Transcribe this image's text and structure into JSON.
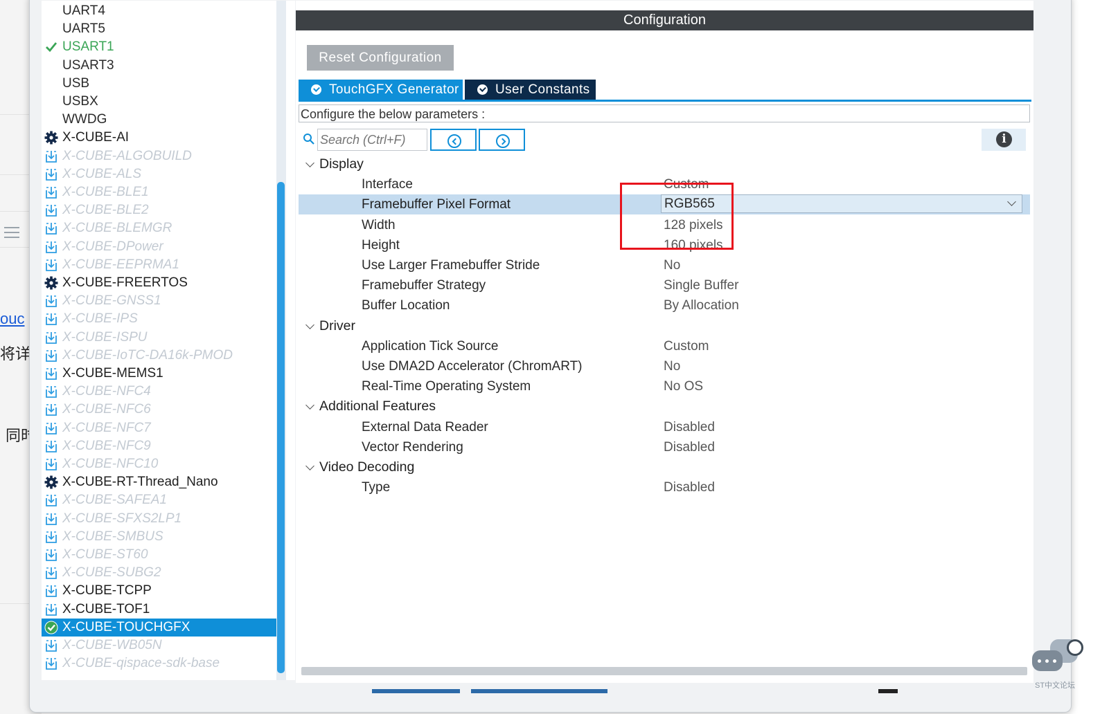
{
  "background": {
    "link_text": "ouc",
    "text_1": "将详",
    "text_2": "同时"
  },
  "tree": {
    "items": [
      {
        "label": "UART4",
        "kind": "plain",
        "icon": ""
      },
      {
        "label": "UART5",
        "kind": "plain",
        "icon": ""
      },
      {
        "label": "USART1",
        "kind": "active",
        "icon": "checkmark-icon"
      },
      {
        "label": "USART3",
        "kind": "plain",
        "icon": ""
      },
      {
        "label": "USB",
        "kind": "plain",
        "icon": ""
      },
      {
        "label": "USBX",
        "kind": "plain",
        "icon": ""
      },
      {
        "label": "WWDG",
        "kind": "plain",
        "icon": ""
      },
      {
        "label": "X-CUBE-AI",
        "kind": "gear",
        "icon": "gear-icon"
      },
      {
        "label": "X-CUBE-ALGOBUILD",
        "kind": "disabled",
        "icon": "download-icon"
      },
      {
        "label": "X-CUBE-ALS",
        "kind": "disabled",
        "icon": "download-icon"
      },
      {
        "label": "X-CUBE-BLE1",
        "kind": "disabled",
        "icon": "download-icon"
      },
      {
        "label": "X-CUBE-BLE2",
        "kind": "disabled",
        "icon": "download-icon"
      },
      {
        "label": "X-CUBE-BLEMGR",
        "kind": "disabled",
        "icon": "download-icon"
      },
      {
        "label": "X-CUBE-DPower",
        "kind": "disabled",
        "icon": "download-icon"
      },
      {
        "label": "X-CUBE-EEPRMA1",
        "kind": "disabled",
        "icon": "download-icon"
      },
      {
        "label": "X-CUBE-FREERTOS",
        "kind": "gear",
        "icon": "gear-icon"
      },
      {
        "label": "X-CUBE-GNSS1",
        "kind": "disabled",
        "icon": "download-icon"
      },
      {
        "label": "X-CUBE-IPS",
        "kind": "disabled",
        "icon": "download-icon"
      },
      {
        "label": "X-CUBE-ISPU",
        "kind": "disabled",
        "icon": "download-icon"
      },
      {
        "label": "X-CUBE-IoTC-DA16k-PMOD",
        "kind": "disabled",
        "icon": "download-icon"
      },
      {
        "label": "X-CUBE-MEMS1",
        "kind": "dl",
        "icon": "download-icon"
      },
      {
        "label": "X-CUBE-NFC4",
        "kind": "disabled",
        "icon": "download-icon"
      },
      {
        "label": "X-CUBE-NFC6",
        "kind": "disabled",
        "icon": "download-icon"
      },
      {
        "label": "X-CUBE-NFC7",
        "kind": "disabled",
        "icon": "download-icon"
      },
      {
        "label": "X-CUBE-NFC9",
        "kind": "disabled",
        "icon": "download-icon"
      },
      {
        "label": "X-CUBE-NFC10",
        "kind": "disabled",
        "icon": "download-icon"
      },
      {
        "label": "X-CUBE-RT-Thread_Nano",
        "kind": "gear",
        "icon": "gear-icon"
      },
      {
        "label": "X-CUBE-SAFEA1",
        "kind": "disabled",
        "icon": "download-icon"
      },
      {
        "label": "X-CUBE-SFXS2LP1",
        "kind": "disabled",
        "icon": "download-icon"
      },
      {
        "label": "X-CUBE-SMBUS",
        "kind": "disabled",
        "icon": "download-icon"
      },
      {
        "label": "X-CUBE-ST60",
        "kind": "disabled",
        "icon": "download-icon"
      },
      {
        "label": "X-CUBE-SUBG2",
        "kind": "disabled",
        "icon": "download-icon"
      },
      {
        "label": "X-CUBE-TCPP",
        "kind": "dl",
        "icon": "download-icon"
      },
      {
        "label": "X-CUBE-TOF1",
        "kind": "dl",
        "icon": "download-icon"
      },
      {
        "label": "X-CUBE-TOUCHGFX",
        "kind": "selected",
        "icon": "check-circle-icon"
      },
      {
        "label": "X-CUBE-WB05N",
        "kind": "disabled",
        "icon": "download-icon"
      },
      {
        "label": "X-CUBE-qispace-sdk-base",
        "kind": "disabled",
        "icon": "download-icon"
      }
    ]
  },
  "config": {
    "header": "Configuration",
    "reset_label": "Reset Configuration",
    "tabs": [
      {
        "label": "TouchGFX Generator",
        "active": true,
        "icon": "check-circle-icon"
      },
      {
        "label": "User Constants",
        "active": false,
        "icon": "check-circle-icon"
      }
    ],
    "description": "Configure the below parameters :",
    "search_placeholder": "Search (Ctrl+F)",
    "groups": [
      {
        "label": "Display",
        "params": [
          {
            "name": "Interface",
            "value": "Custom"
          },
          {
            "name": "Framebuffer Pixel Format",
            "value": "RGB565",
            "selected": true
          },
          {
            "name": "Width",
            "value": "128 pixels"
          },
          {
            "name": "Height",
            "value": "160 pixels"
          },
          {
            "name": "Use Larger Framebuffer Stride",
            "value": "No"
          },
          {
            "name": "Framebuffer Strategy",
            "value": "Single Buffer"
          },
          {
            "name": "Buffer Location",
            "value": "By Allocation"
          }
        ]
      },
      {
        "label": "Driver",
        "params": [
          {
            "name": "Application Tick Source",
            "value": "Custom"
          },
          {
            "name": "Use DMA2D Accelerator (ChromART)",
            "value": "No"
          },
          {
            "name": "Real-Time Operating System",
            "value": "No OS"
          }
        ]
      },
      {
        "label": "Additional Features",
        "params": [
          {
            "name": "External Data Reader",
            "value": "Disabled"
          },
          {
            "name": "Vector Rendering",
            "value": "Disabled"
          }
        ]
      },
      {
        "label": "Video Decoding",
        "params": [
          {
            "name": "Type",
            "value": "Disabled"
          }
        ]
      }
    ]
  },
  "colors": {
    "accent": "#0f8fd8",
    "header_bg": "#3d4145",
    "highlight_red": "#e8141d",
    "active_green": "#3aa556"
  },
  "chat_widget": {
    "label": "ST中文论坛"
  }
}
